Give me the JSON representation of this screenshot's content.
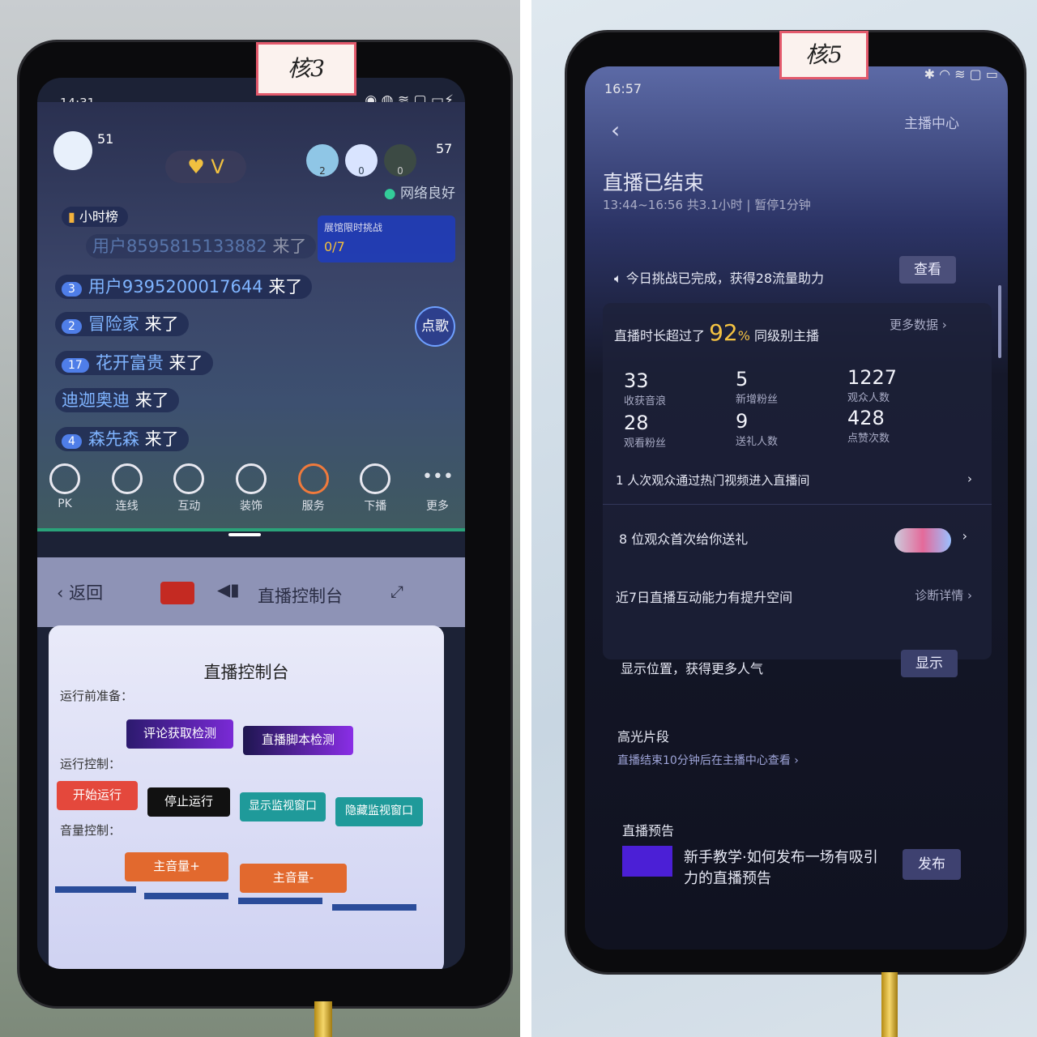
{
  "left_phone": {
    "note": "核3",
    "status_bar": {
      "time": "14:31"
    },
    "stream": {
      "viewer_count_left": "51",
      "viewer_count_right": "57",
      "audience_badges": [
        "2",
        "0",
        "0"
      ],
      "hour_rank": "小时榜",
      "network": "网络良好",
      "challenge": {
        "title": "展馆限时挑战",
        "progress": "0/7"
      },
      "song_button": "点歌",
      "chat": [
        {
          "level": "",
          "user": "用户8595815133882",
          "text": "来了"
        },
        {
          "level": "3",
          "user": "用户9395200017644",
          "text": "来了"
        },
        {
          "level": "2",
          "user": "冒险家",
          "text": "来了"
        },
        {
          "level": "17",
          "user": "花开富贵",
          "text": "来了"
        },
        {
          "level": "",
          "user": "迪迦奥迪",
          "text": "来了"
        },
        {
          "level": "4",
          "user": "森先森",
          "text": "来了"
        }
      ],
      "tools": [
        "PK",
        "连线",
        "互动",
        "装饰",
        "服务",
        "下播",
        "更多"
      ]
    },
    "control_bar": {
      "back": "返回",
      "title": "直播控制台"
    },
    "console": {
      "title": "直播控制台",
      "sections": {
        "prep": "运行前准备：",
        "run": "运行控制：",
        "volume": "音量控制："
      },
      "prep_buttons": [
        "评论获取检测",
        "直播脚本检测"
      ],
      "run_buttons": [
        "开始运行",
        "停止运行",
        "显示监视窗口",
        "隐藏监视窗口"
      ],
      "volume_buttons": [
        "主音量+",
        "主音量-"
      ]
    }
  },
  "right_phone": {
    "note": "核5",
    "status_bar": {
      "time": "16:57"
    },
    "header": {
      "anchor_center": "主播中心",
      "title": "直播已结束",
      "subtitle": "13:44~16:56 共3.1小时 | 暂停1分钟"
    },
    "challenge": {
      "text": "今日挑战已完成，获得28流量助力",
      "button": "查看"
    },
    "summary": {
      "prefix": "直播时长超过了",
      "percent": "92",
      "unit": "%",
      "suffix": "同级别主播",
      "more": "更多数据"
    },
    "stats": [
      {
        "value": "33",
        "label": "收获音浪"
      },
      {
        "value": "5",
        "label": "新增粉丝"
      },
      {
        "value": "1227",
        "label": "观众人数"
      },
      {
        "value": "28",
        "label": "观看粉丝"
      },
      {
        "value": "9",
        "label": "送礼人数"
      },
      {
        "value": "428",
        "label": "点赞次数"
      }
    ],
    "hot_video": "1 人次观众通过热门视频进入直播间",
    "gifts": "8 位观众首次给你送礼",
    "interaction": {
      "text": "近7日直播互动能力有提升空间",
      "link": "诊断详情"
    },
    "location": {
      "text": "显示位置，获得更多人气",
      "button": "显示"
    },
    "highlights": {
      "title": "高光片段",
      "text": "直播结束10分钟后在主播中心查看"
    },
    "preview": {
      "title": "直播预告",
      "text": "新手教学·如何发布一场有吸引力的直播预告",
      "button": "发布"
    },
    "accent": "#f5c342"
  }
}
